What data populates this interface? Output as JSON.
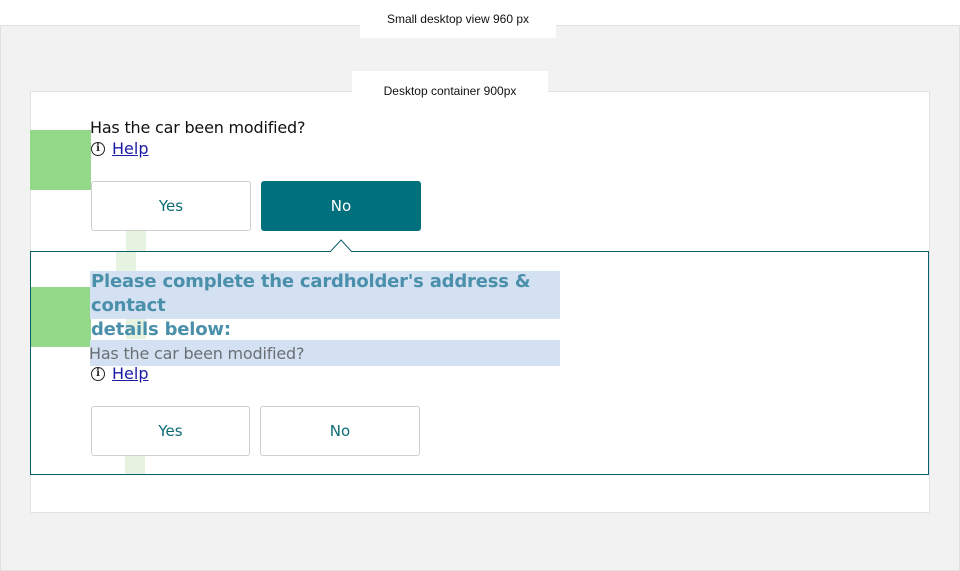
{
  "labels": {
    "outer": "Small desktop view 960 px",
    "inner": "Desktop container 900px"
  },
  "question1": {
    "text": "Has the car been modified?",
    "help": "Help",
    "options": {
      "yes": "Yes",
      "no": "No"
    },
    "selected": "No"
  },
  "panel": {
    "heading_line1": "Please complete the cardholder's address & contact",
    "heading_line2": "details below:",
    "question": {
      "text": "Has the car been modified?",
      "help": "Help",
      "options": {
        "yes": "Yes",
        "no": "No"
      },
      "selected": ""
    }
  },
  "icons": {
    "help": "info-circle-icon",
    "help_glyph": "i"
  },
  "colors": {
    "selected_button": "#00707d",
    "button_text": "#0d6b74",
    "panel_border": "#0b5f6a",
    "heading": "#4a90ab",
    "link": "#1a1aa6"
  }
}
